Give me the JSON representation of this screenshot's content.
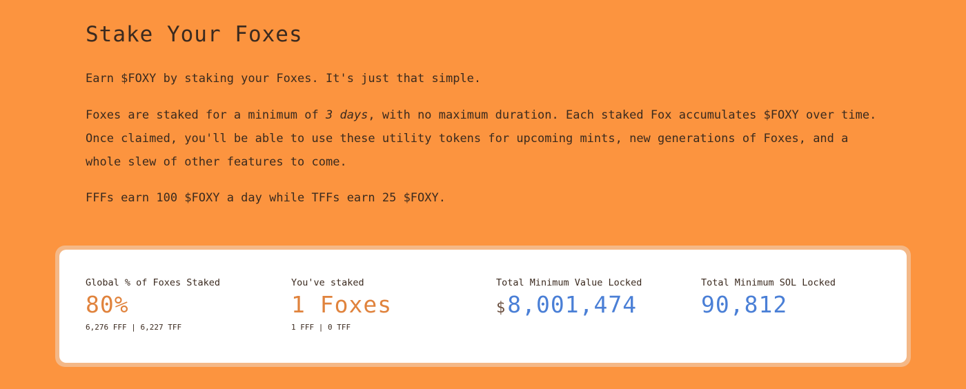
{
  "header": {
    "title": "Stake Your Foxes"
  },
  "intro": {
    "p1": "Earn $FOXY by staking your Foxes. It's just that simple.",
    "p2_before": "Foxes are staked for a minimum of ",
    "p2_emphasis": "3 days",
    "p2_after": ", with no maximum duration. Each staked Fox accumulates $FOXY over time. Once claimed, you'll be able to use these utility tokens for upcoming mints, new generations of Foxes, and a whole slew of other features to come.",
    "p3": "FFFs earn 100 $FOXY a day while TFFs earn 25 $FOXY."
  },
  "stats": {
    "global": {
      "label": "Global % of Foxes Staked",
      "value": "80%",
      "sub": "6,276 FFF | 6,227 TFF"
    },
    "yours": {
      "label": "You've staked",
      "value": "1 Foxes",
      "sub": "1 FFF | 0 TFF"
    },
    "tvl": {
      "label": "Total Minimum Value Locked",
      "currency": "$",
      "value": "8,001,474"
    },
    "sol": {
      "label": "Total Minimum SOL Locked",
      "value": "90,812"
    }
  },
  "colors": {
    "background": "#FC943F",
    "card": "#FFFFFF",
    "accent_orange": "#E0833D",
    "accent_blue": "#4A7FD6",
    "text": "#3B2A1F"
  }
}
